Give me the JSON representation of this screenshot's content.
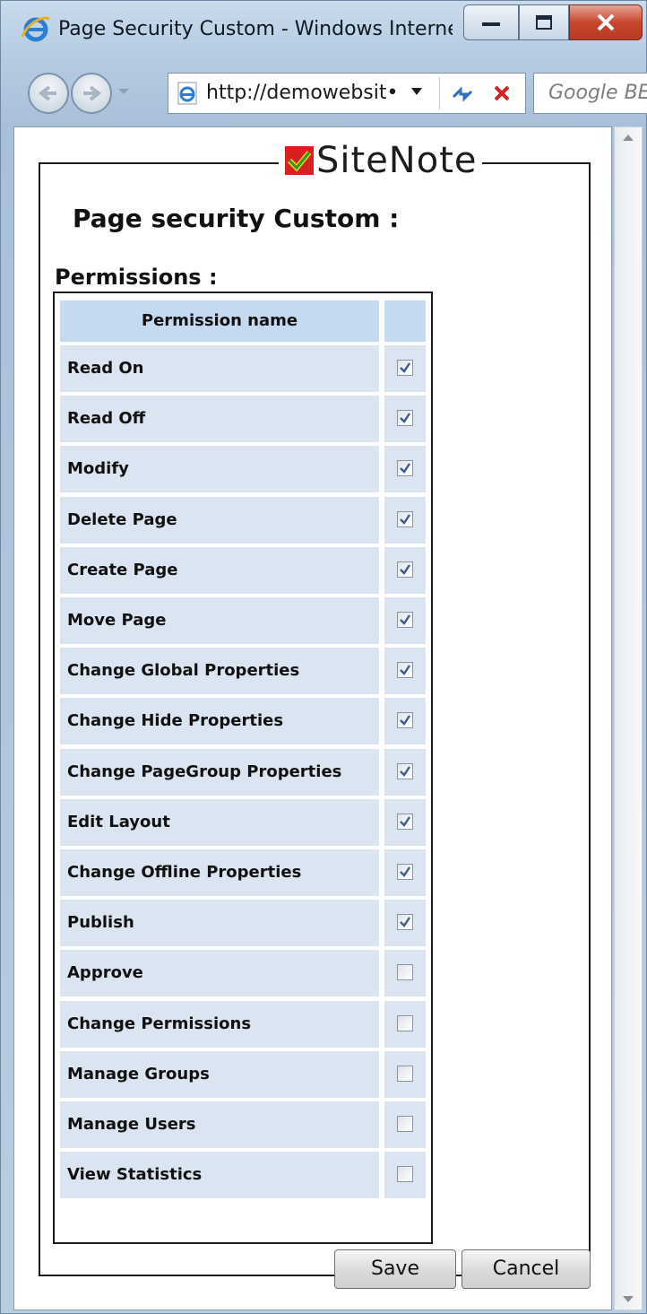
{
  "window": {
    "title": "Page Security Custom - Windows Interne...",
    "address": "http://demowebsit•",
    "search_placeholder": "Google BE"
  },
  "logo": {
    "text": "SiteNote"
  },
  "page": {
    "title": "Page security Custom :",
    "permissions_label": "Permissions :"
  },
  "table": {
    "header_name": "Permission name",
    "header_check": "",
    "rows": [
      {
        "name": "Read On",
        "checked": true
      },
      {
        "name": "Read Off",
        "checked": true
      },
      {
        "name": "Modify",
        "checked": true
      },
      {
        "name": "Delete Page",
        "checked": true
      },
      {
        "name": "Create Page",
        "checked": true
      },
      {
        "name": "Move Page",
        "checked": true
      },
      {
        "name": "Change Global Properties",
        "checked": true
      },
      {
        "name": "Change Hide Properties",
        "checked": true
      },
      {
        "name": "Change PageGroup Properties",
        "checked": true
      },
      {
        "name": "Edit Layout",
        "checked": true
      },
      {
        "name": "Change Offline Properties",
        "checked": true
      },
      {
        "name": "Publish",
        "checked": true
      },
      {
        "name": "Approve",
        "checked": false
      },
      {
        "name": "Change Permissions",
        "checked": false
      },
      {
        "name": "Manage Groups",
        "checked": false
      },
      {
        "name": "Manage Users",
        "checked": false
      },
      {
        "name": "View Statistics",
        "checked": false
      }
    ]
  },
  "buttons": {
    "save": "Save",
    "cancel": "Cancel"
  },
  "icons": {
    "browser": "ie-icon",
    "back": "back-arrow-icon",
    "forward": "forward-arrow-icon",
    "page": "ie-page-icon",
    "refresh": "refresh-icon",
    "stop": "stop-icon",
    "minimize": "minimize-icon",
    "maximize": "maximize-icon",
    "close": "close-icon",
    "logo": "sitenote-check-icon"
  },
  "colors": {
    "header_bg": "#c5d9f1",
    "row_bg": "#dbe5f1",
    "close_red": "#c7462c"
  }
}
